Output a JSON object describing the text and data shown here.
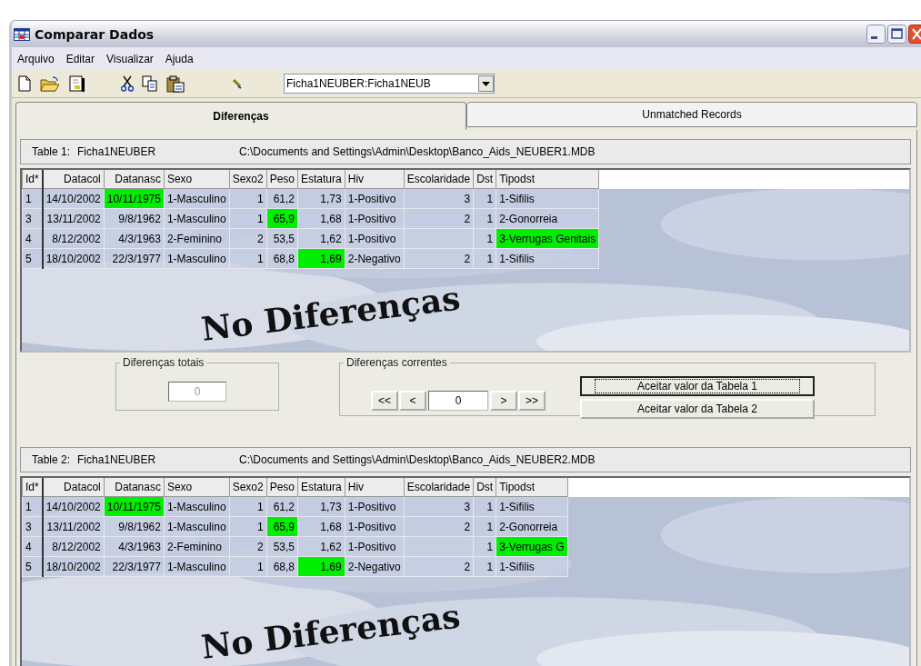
{
  "window": {
    "title": "Comparar Dados"
  },
  "menu": [
    "Arquivo",
    "Editar",
    "Visualizar",
    "Ajuda"
  ],
  "toolbar": {
    "combo_value": "Ficha1NEUBER:Ficha1NEUB"
  },
  "tabs": [
    {
      "label": "Diferenças",
      "selected": true
    },
    {
      "label": "Unmatched Records",
      "selected": false
    }
  ],
  "tables": [
    {
      "label": "Table 1:",
      "name": "Ficha1NEUBER",
      "path": "C:\\Documents and Settings\\Admin\\Desktop\\Banco_Aids_NEUBER1.MDB",
      "overlay": "No Diferenças",
      "columns": [
        "Id*",
        "Datacol",
        "Datanasc",
        "Sexo",
        "Sexo2",
        "Peso",
        "Estatura",
        "Hiv",
        "Escolaridade",
        "Dst",
        "Tipodst"
      ],
      "rows": [
        {
          "cells": [
            {
              "v": "1",
              "changed": false
            },
            {
              "v": "14/10/2002",
              "changed": false
            },
            {
              "v": "10/11/1975",
              "changed": true
            },
            {
              "v": "1-Masculino",
              "changed": false
            },
            {
              "v": "1",
              "changed": false
            },
            {
              "v": "61,2",
              "changed": false
            },
            {
              "v": "1,73",
              "changed": false
            },
            {
              "v": "1-Positivo",
              "changed": false
            },
            {
              "v": "3",
              "changed": false
            },
            {
              "v": "1",
              "changed": false
            },
            {
              "v": "1-Sifilis",
              "changed": false
            }
          ]
        },
        {
          "cells": [
            {
              "v": "3",
              "changed": false
            },
            {
              "v": "13/11/2002",
              "changed": false
            },
            {
              "v": "9/8/1962",
              "changed": false
            },
            {
              "v": "1-Masculino",
              "changed": false
            },
            {
              "v": "1",
              "changed": false
            },
            {
              "v": "65,9",
              "changed": true
            },
            {
              "v": "1,68",
              "changed": false
            },
            {
              "v": "1-Positivo",
              "changed": false
            },
            {
              "v": "2",
              "changed": false
            },
            {
              "v": "1",
              "changed": false
            },
            {
              "v": "2-Gonorreia",
              "changed": false
            }
          ]
        },
        {
          "cells": [
            {
              "v": "4",
              "changed": false
            },
            {
              "v": "8/12/2002",
              "changed": false
            },
            {
              "v": "4/3/1963",
              "changed": false
            },
            {
              "v": "2-Feminino",
              "changed": false
            },
            {
              "v": "2",
              "changed": false
            },
            {
              "v": "53,5",
              "changed": false
            },
            {
              "v": "1,62",
              "changed": false
            },
            {
              "v": "1-Positivo",
              "changed": false
            },
            {
              "changed": false
            },
            {
              "v": "1",
              "changed": false
            },
            {
              "v": "3-Verrugas Genitais",
              "changed": true
            }
          ]
        },
        {
          "cells": [
            {
              "v": "5",
              "changed": false
            },
            {
              "v": "18/10/2002",
              "changed": false
            },
            {
              "v": "22/3/1977",
              "changed": false
            },
            {
              "v": "1-Masculino",
              "changed": false
            },
            {
              "v": "1",
              "changed": false
            },
            {
              "v": "68,8",
              "changed": false
            },
            {
              "v": "1,69",
              "changed": true
            },
            {
              "v": "2-Negativo",
              "changed": false
            },
            {
              "v": "2",
              "changed": false
            },
            {
              "v": "1",
              "changed": false
            },
            {
              "v": "1-Sifilis",
              "changed": false
            }
          ]
        }
      ]
    },
    {
      "label": "Table 2:",
      "name": "Ficha1NEUBER",
      "path": "C:\\Documents and Settings\\Admin\\Desktop\\Banco_Aids_NEUBER2.MDB",
      "overlay": "No Diferenças",
      "columns": [
        "Id*",
        "Datacol",
        "Datanasc",
        "Sexo",
        "Sexo2",
        "Peso",
        "Estatura",
        "Hiv",
        "Escolaridade",
        "Dst",
        "Tipodst"
      ],
      "rows": [
        {
          "cells": [
            {
              "v": "1",
              "changed": false
            },
            {
              "v": "14/10/2002",
              "changed": false
            },
            {
              "v": "10/11/1975",
              "changed": true
            },
            {
              "v": "1-Masculino",
              "changed": false
            },
            {
              "v": "1",
              "changed": false
            },
            {
              "v": "61,2",
              "changed": false
            },
            {
              "v": "1,73",
              "changed": false
            },
            {
              "v": "1-Positivo",
              "changed": false
            },
            {
              "v": "3",
              "changed": false
            },
            {
              "v": "1",
              "changed": false
            },
            {
              "v": "1-Sifilis",
              "changed": false
            }
          ]
        },
        {
          "cells": [
            {
              "v": "3",
              "changed": false
            },
            {
              "v": "13/11/2002",
              "changed": false
            },
            {
              "v": "9/8/1962",
              "changed": false
            },
            {
              "v": "1-Masculino",
              "changed": false
            },
            {
              "v": "1",
              "changed": false
            },
            {
              "v": "65,9",
              "changed": true
            },
            {
              "v": "1,68",
              "changed": false
            },
            {
              "v": "1-Positivo",
              "changed": false
            },
            {
              "v": "2",
              "changed": false
            },
            {
              "v": "1",
              "changed": false
            },
            {
              "v": "2-Gonorreia",
              "changed": false
            }
          ]
        },
        {
          "cells": [
            {
              "v": "4",
              "changed": false
            },
            {
              "v": "8/12/2002",
              "changed": false
            },
            {
              "v": "4/3/1963",
              "changed": false
            },
            {
              "v": "2-Feminino",
              "changed": false
            },
            {
              "v": "2",
              "changed": false
            },
            {
              "v": "53,5",
              "changed": false
            },
            {
              "v": "1,62",
              "changed": false
            },
            {
              "v": "1-Positivo",
              "changed": false
            },
            {
              "changed": false
            },
            {
              "v": "1",
              "changed": false
            },
            {
              "v": "3-Verrugas G",
              "changed": true
            }
          ]
        },
        {
          "cells": [
            {
              "v": "5",
              "changed": false
            },
            {
              "v": "18/10/2002",
              "changed": false
            },
            {
              "v": "22/3/1977",
              "changed": false
            },
            {
              "v": "1-Masculino",
              "changed": false
            },
            {
              "v": "1",
              "changed": false
            },
            {
              "v": "68,8",
              "changed": false
            },
            {
              "v": "1,69",
              "changed": true
            },
            {
              "v": "2-Negativo",
              "changed": false
            },
            {
              "v": "2",
              "changed": false
            },
            {
              "v": "1",
              "changed": false
            },
            {
              "v": "1-Sifilis",
              "changed": false
            }
          ]
        }
      ]
    }
  ],
  "totals": {
    "legend": "Diferenças totais",
    "value": "0"
  },
  "current": {
    "legend": "Diferenças correntes",
    "nav": [
      "<<",
      "<",
      "0",
      ">",
      ">>"
    ],
    "buttons": [
      {
        "label": "Aceitar valor da Tabela 1",
        "focused": true
      },
      {
        "label": "Aceitar valor da Tabela 2",
        "focused": false
      }
    ]
  }
}
